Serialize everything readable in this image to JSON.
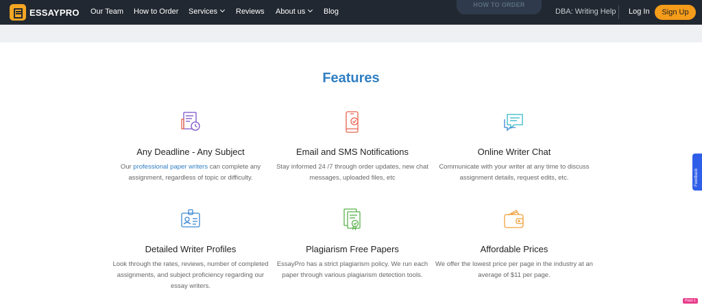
{
  "nav": {
    "logo_text": "ESSAYPRO",
    "items": [
      {
        "label": "Our Team"
      },
      {
        "label": "How to Order"
      },
      {
        "label": "Services"
      },
      {
        "label": "Reviews"
      },
      {
        "label": "About us"
      },
      {
        "label": "Blog"
      }
    ],
    "order_button": "How to order",
    "dba": "DBA: Writing Help",
    "login": "Log In",
    "signup": "Sign Up"
  },
  "features": {
    "title": "Features",
    "items": [
      {
        "icon": "document-clock-icon",
        "title": "Any Deadline - Any Subject",
        "text_pre": "Our ",
        "text_link": "professional paper writers",
        "text_post": " can complete any assignment, regardless of topic or difficulty."
      },
      {
        "icon": "phone-check-icon",
        "title": "Email and SMS Notifications",
        "text": "Stay informed 24 /7 through order updates, new chat messages, uploaded files, etc"
      },
      {
        "icon": "chat-bubble-icon",
        "title": "Online Writer Chat",
        "text": "Communicate with your writer at any time to discuss assignment details, request edits, etc."
      },
      {
        "icon": "id-card-icon",
        "title": "Detailed Writer Profiles",
        "text": "Look through the rates, reviews, number of completed assignments, and subject proficiency regarding our essay writers."
      },
      {
        "icon": "certificate-check-icon",
        "title": "Plagiarism Free Papers",
        "text": "EssayPro has a strict plagiarism policy. We run each paper through various plagiarism detection tools."
      },
      {
        "icon": "wallet-icon",
        "title": "Affordable Prices",
        "text": "We offer the lowest price per page in the industry at an average of $11 per page."
      }
    ]
  },
  "widgets": {
    "feedback": "Feedback",
    "badge": "Point 1 Me"
  },
  "colors": {
    "nav_bg": "#222831",
    "accent_blue": "#2e7ec3",
    "signup_orange": "#f59c1a",
    "icon_purple": "#7b4fc9",
    "icon_red": "#e8604a",
    "icon_teal": "#2eb6c6",
    "icon_blue": "#3a86d0",
    "icon_green": "#58b04a",
    "icon_orange": "#f0a03a"
  }
}
